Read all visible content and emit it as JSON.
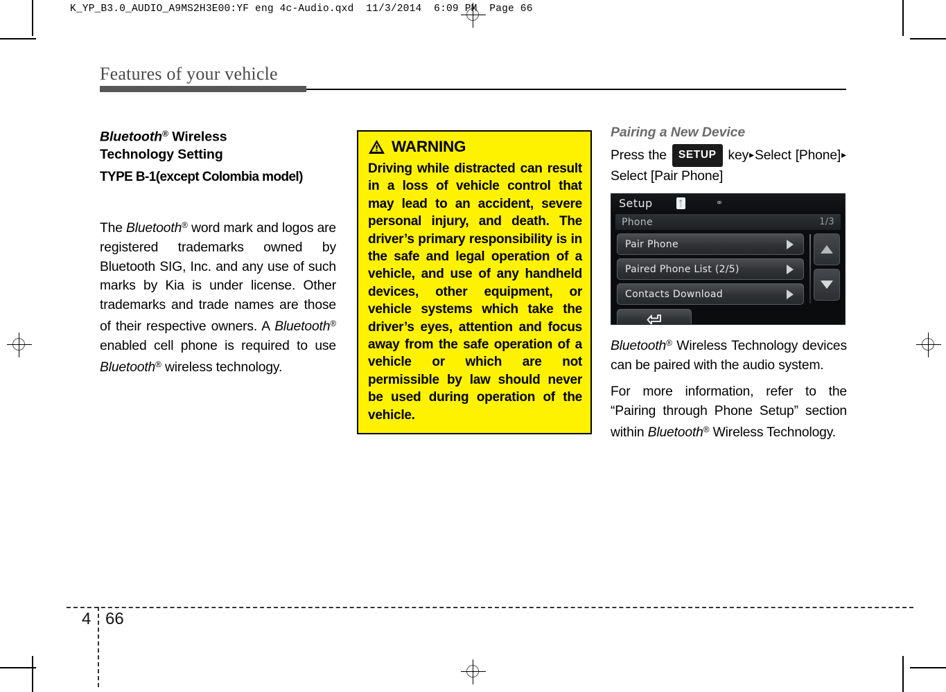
{
  "prepress": {
    "header_line": "K_YP_B3.0_AUDIO_A9MS2H3E00:YF eng 4c-Audio.qxd  11/3/2014  6:09 PM  Page 66"
  },
  "page": {
    "running_title": "Features of your vehicle",
    "chapter_number": "4",
    "page_number": "66"
  },
  "left_column": {
    "heading_line1_pre": "Bluetooth",
    "heading_line1_post": " Wireless",
    "heading_line2": "Technology Setting",
    "subheading": "TYPE B-1(except Colombia model)",
    "paragraph": {
      "p1": "The ",
      "bt1": "Bluetooth",
      "p2": " word mark and logos are registered trademarks owned by Bluetooth SIG, Inc. and any use of such marks by Kia is under license. Other trademarks and trade names are those of their respective owners. A ",
      "bt2": "Bluetooth",
      "p3": " enabled cell phone is required to use ",
      "bt3": "Bluetooth",
      "p4": " wireless technology."
    }
  },
  "warning": {
    "icon": "warning-triangle-icon",
    "title": "WARNING",
    "body": "Driving while distracted can result in a loss of vehicle control that may lead to an accident, severe personal injury, and death. The driver’s primary responsibility is in the safe and legal operation of a vehicle, and use of any handheld devices, other equipment, or vehicle systems which take the driver’s eyes, attention and focus away from the safe operation of a vehicle or which are not permissible by law should never be used during operation of the vehicle.",
    "background_color": "#fff200",
    "border_color": "#000000"
  },
  "right_column": {
    "heading": "Pairing a New Device",
    "instruction": {
      "press": "Press",
      "the": "the",
      "key_chip": "SETUP",
      "key_word": "key",
      "arrow": "▸",
      "select1": "Select",
      "phone_bracket": "[Phone]",
      "select2": "Select",
      "pair_phone_bracket": "[Pair Phone]"
    },
    "paragraph1": {
      "bt": "Bluetooth",
      "rest": " Wireless Technology devices can be paired with the audio system."
    },
    "paragraph2": {
      "p1": "For more information, refer to the “Pairing through Phone Setup” section within ",
      "bt": "Bluetooth",
      "p2": " Wireless Technology."
    }
  },
  "head_unit_screen": {
    "title": "Setup",
    "status_icons": [
      "bluetooth-icon",
      "usb-icon"
    ],
    "section_label": "Phone",
    "page_indicator": "1/3",
    "menu_items": [
      {
        "label": "Pair Phone",
        "chevron": "▶"
      },
      {
        "label": "Paired Phone List (2/5)",
        "chevron": "▶"
      },
      {
        "label": "Contacts Download",
        "chevron": "▶"
      }
    ],
    "back_button_icon": "↩",
    "scroll_up_icon": "▲",
    "scroll_down_icon": "▼"
  }
}
